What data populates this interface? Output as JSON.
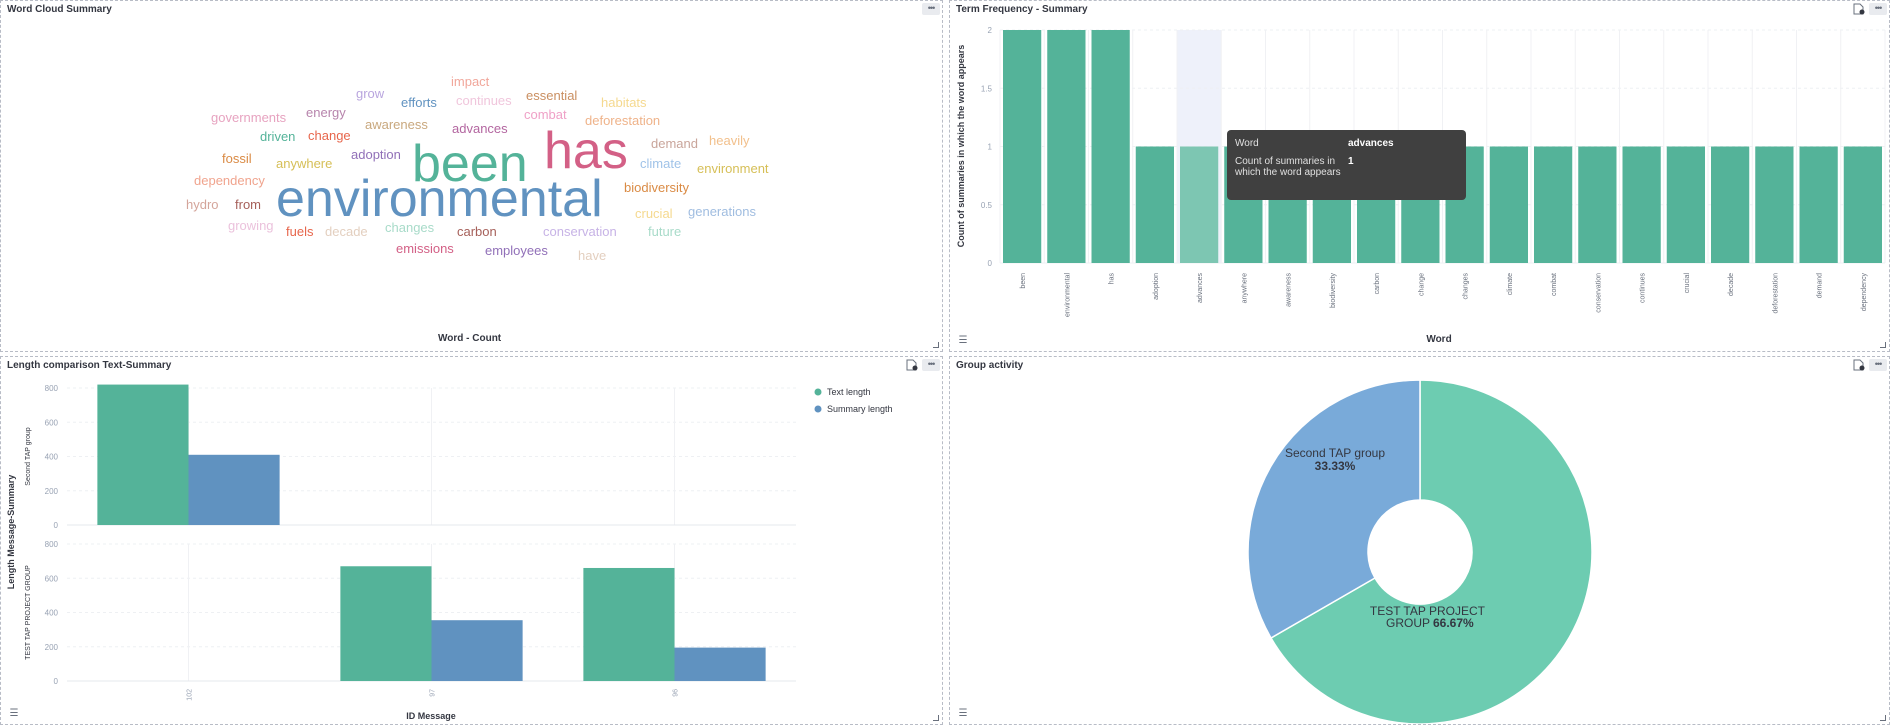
{
  "panels": {
    "word_cloud": {
      "title": "Word Cloud Summary",
      "footer_label": "Word - Count"
    },
    "term_frequency": {
      "title": "Term Frequency - Summary"
    },
    "length_comparison": {
      "title": "Length comparison Text-Summary"
    },
    "group_activity": {
      "title": "Group activity"
    }
  },
  "icons": {
    "menu": "ellipsis-icon",
    "inspect": "inspect-icon",
    "legend": "legend-toggle-icon",
    "resize": "resize-handle-icon"
  },
  "colors": {
    "green": "#54b399",
    "blue": "#6092c0",
    "pie_green": "#6dccb1",
    "pie_blue": "#79aad9",
    "highlight": "#7dc6b2",
    "tooltip_bg": "#404040"
  },
  "tooltip": {
    "rows": [
      {
        "label": "Word",
        "value": "advances"
      },
      {
        "label": "Count of summaries in which the word appears",
        "value": "1"
      }
    ]
  },
  "chart_data": [
    {
      "type": "wordcloud",
      "title": "Word Cloud Summary",
      "xlabel": "Word - Count",
      "words": [
        {
          "text": "environmental",
          "weight": 2,
          "color": "#6092c0"
        },
        {
          "text": "has",
          "weight": 2,
          "color": "#d36086"
        },
        {
          "text": "been",
          "weight": 2,
          "color": "#54b399"
        },
        {
          "text": "governments",
          "weight": 1,
          "color": "#e7a3c0"
        },
        {
          "text": "energy",
          "weight": 1,
          "color": "#b784ac"
        },
        {
          "text": "grow",
          "weight": 1,
          "color": "#b9a5de"
        },
        {
          "text": "efforts",
          "weight": 1,
          "color": "#6092c0"
        },
        {
          "text": "impact",
          "weight": 1,
          "color": "#f1a79b"
        },
        {
          "text": "continues",
          "weight": 1,
          "color": "#f0c6dc"
        },
        {
          "text": "essential",
          "weight": 1,
          "color": "#ca8f61"
        },
        {
          "text": "habitats",
          "weight": 1,
          "color": "#f5d98f"
        },
        {
          "text": "driven",
          "weight": 1,
          "color": "#54b399"
        },
        {
          "text": "change",
          "weight": 1,
          "color": "#e7664c"
        },
        {
          "text": "awareness",
          "weight": 1,
          "color": "#c9a87e"
        },
        {
          "text": "advances",
          "weight": 1,
          "color": "#b366a0"
        },
        {
          "text": "combat",
          "weight": 1,
          "color": "#efa1c7"
        },
        {
          "text": "deforestation",
          "weight": 1,
          "color": "#efb38a"
        },
        {
          "text": "fossil",
          "weight": 1,
          "color": "#da8b45"
        },
        {
          "text": "anywhere",
          "weight": 1,
          "color": "#d6bf57"
        },
        {
          "text": "adoption",
          "weight": 1,
          "color": "#9170b8"
        },
        {
          "text": "demand",
          "weight": 1,
          "color": "#c9a59b"
        },
        {
          "text": "heavily",
          "weight": 1,
          "color": "#f2c08c"
        },
        {
          "text": "climate",
          "weight": 1,
          "color": "#a0c3e8"
        },
        {
          "text": "environment",
          "weight": 1,
          "color": "#d6bf57"
        },
        {
          "text": "dependency",
          "weight": 1,
          "color": "#f0a48e"
        },
        {
          "text": "biodiversity",
          "weight": 1,
          "color": "#da8b45"
        },
        {
          "text": "hydro",
          "weight": 1,
          "color": "#d4a59b"
        },
        {
          "text": "from",
          "weight": 1,
          "color": "#a6605a"
        },
        {
          "text": "crucial",
          "weight": 1,
          "color": "#f5d98f"
        },
        {
          "text": "generations",
          "weight": 1,
          "color": "#a0bde0"
        },
        {
          "text": "growing",
          "weight": 1,
          "color": "#ebc2dc"
        },
        {
          "text": "fuels",
          "weight": 1,
          "color": "#e7664c"
        },
        {
          "text": "decade",
          "weight": 1,
          "color": "#e3cfbf"
        },
        {
          "text": "changes",
          "weight": 1,
          "color": "#a8dbc9"
        },
        {
          "text": "carbon",
          "weight": 1,
          "color": "#a6605a"
        },
        {
          "text": "conservation",
          "weight": 1,
          "color": "#c7b3e6"
        },
        {
          "text": "future",
          "weight": 1,
          "color": "#a8dbc9"
        },
        {
          "text": "emissions",
          "weight": 1,
          "color": "#d36086"
        },
        {
          "text": "employees",
          "weight": 1,
          "color": "#9170b8"
        },
        {
          "text": "have",
          "weight": 1,
          "color": "#e3cfbf"
        }
      ]
    },
    {
      "type": "bar",
      "title": "Term Frequency - Summary",
      "xlabel": "Word",
      "ylabel": "Count of summaries in which the word appears",
      "ylim": [
        0,
        2
      ],
      "yticks": [
        "0",
        "0.5",
        "1",
        "1.5",
        "2"
      ],
      "categories": [
        "been",
        "environmental",
        "has",
        "adoption",
        "advances",
        "anywhere",
        "awareness",
        "biodiversity",
        "carbon",
        "change",
        "changes",
        "climate",
        "combat",
        "conservation",
        "continues",
        "crucial",
        "decade",
        "deforestation",
        "demand",
        "dependency"
      ],
      "values": [
        2,
        2,
        2,
        1,
        1,
        1,
        1,
        1,
        1,
        1,
        1,
        1,
        1,
        1,
        1,
        1,
        1,
        1,
        1,
        1
      ],
      "highlighted": "advances",
      "grid": true
    },
    {
      "type": "bar",
      "title": "Length comparison Text-Summary",
      "xlabel": "ID Message",
      "ylabel": "Length Message-Summary",
      "categories": [
        "102",
        "97",
        "96"
      ],
      "legend": [
        "Text length",
        "Summary length"
      ],
      "legend_position": "top-right",
      "ylim": [
        0,
        800
      ],
      "yticks": [
        "0",
        "200",
        "400",
        "600",
        "800"
      ],
      "rows": [
        {
          "name": "Second TAP group",
          "series": [
            {
              "name": "Text length",
              "values": [
                820,
                null,
                null
              ]
            },
            {
              "name": "Summary length",
              "values": [
                410,
                null,
                null
              ]
            }
          ]
        },
        {
          "name": "TEST TAP PROJECT GROUP",
          "series": [
            {
              "name": "Text length",
              "values": [
                null,
                670,
                660
              ]
            },
            {
              "name": "Summary length",
              "values": [
                null,
                355,
                195
              ]
            }
          ]
        }
      ]
    },
    {
      "type": "pie",
      "title": "Group activity",
      "donut": true,
      "slices": [
        {
          "label": "TEST TAP PROJECT GROUP",
          "percent_label": "66.67%",
          "value": 66.67
        },
        {
          "label": "Second TAP group",
          "percent_label": "33.33%",
          "value": 33.33
        }
      ]
    }
  ]
}
